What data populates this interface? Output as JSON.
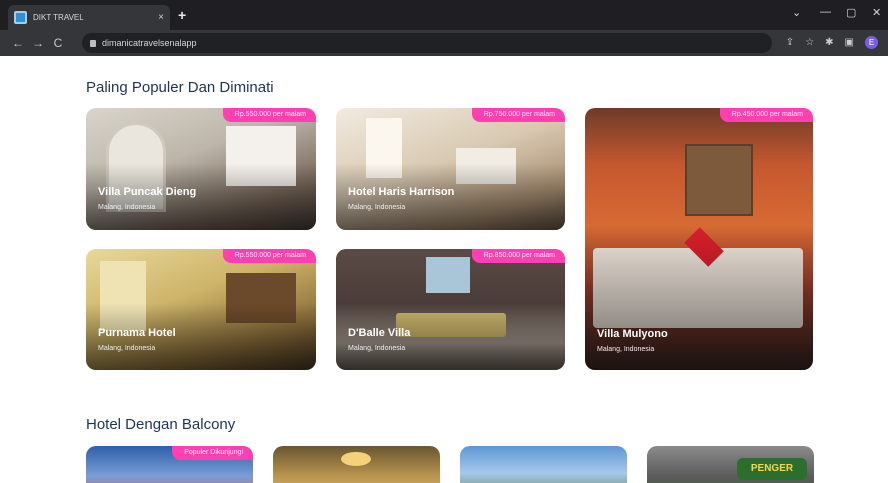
{
  "browser": {
    "tab_title": "DIKT TRAVEL",
    "tab_close": "×",
    "new_tab": "+",
    "url": "dimanicatravelsenalapp",
    "window_controls": [
      "⌄",
      "—",
      "▢",
      "✕"
    ],
    "nav": [
      "←",
      "→",
      "C"
    ],
    "toolbar_icons": [
      "⇪",
      "☆",
      "✱",
      "▣"
    ],
    "profile_initial": "E"
  },
  "section_popular": {
    "title": "Paling Populer Dan Diminati",
    "cards": [
      {
        "name": "Villa Puncak Dieng",
        "location": "Malang, Indonesia",
        "price": "Rp.550.000 per malam"
      },
      {
        "name": "Hotel Haris Harrison",
        "location": "Malang, Indonesia",
        "price": "Rp.750.000 per malam"
      },
      {
        "name": "Villa Mulyono",
        "location": "Malang, Indonesia",
        "price": "Rp.450.000 per malam"
      },
      {
        "name": "Purnama Hotel",
        "location": "Malang, Indonesia",
        "price": "Rp.550.000 per malam"
      },
      {
        "name": "D'Balle Villa",
        "location": "Malang, Indonesia",
        "price": "Rp.850.000 per malam"
      }
    ]
  },
  "section_balcony": {
    "title": "Hotel Dengan Balcony",
    "first_badge": "Populer Dikunjungi",
    "sign_text": "PENGER"
  },
  "colors": {
    "accent_pink": "#ff3fb2",
    "title_navy": "#1e3554",
    "chrome_dark": "#1f1f23"
  }
}
